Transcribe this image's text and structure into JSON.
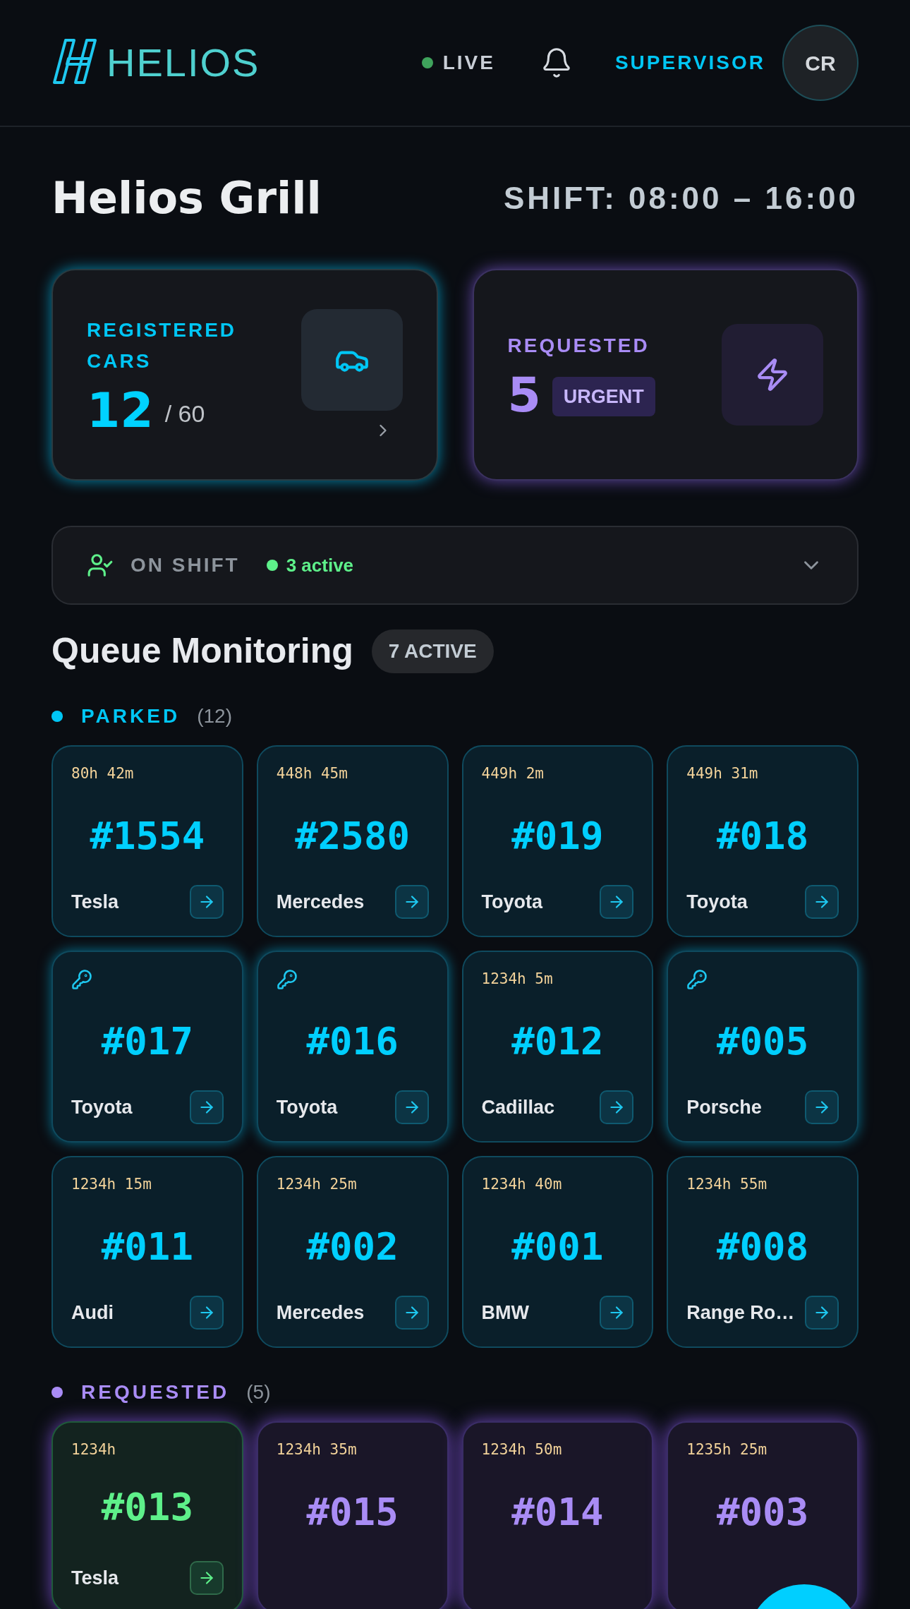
{
  "header": {
    "logo": "HELIOS",
    "live": {
      "label": "LIVE",
      "on": true
    },
    "role": "SUPERVISOR",
    "avatar": "CR"
  },
  "venue": {
    "title": "Helios Grill",
    "shift": "SHIFT: 08:00 – 16:00"
  },
  "stats": [
    {
      "kind": "registered",
      "label": "REGISTERED CARS",
      "value": "12",
      "total": "/ 60"
    },
    {
      "kind": "requested",
      "label": "REQUESTED",
      "value": "5",
      "badge": "URGENT"
    }
  ],
  "on_shift": {
    "label": "ON SHIFT",
    "status": "3 active",
    "expanded": false
  },
  "queue": {
    "title": "Queue Monitoring",
    "badge": "7 ACTIVE"
  },
  "sections": [
    {
      "kind": "parked",
      "label": "PARKED",
      "count": "(12)",
      "tiles": [
        {
          "timer": "80h 42m",
          "key": false,
          "ticket": "#1554",
          "make": "Tesla"
        },
        {
          "timer": "448h 45m",
          "key": false,
          "ticket": "#2580",
          "make": "Mercedes"
        },
        {
          "timer": "449h 2m",
          "key": false,
          "ticket": "#019",
          "make": "Toyota"
        },
        {
          "timer": "449h 31m",
          "key": false,
          "ticket": "#018",
          "make": "Toyota"
        },
        {
          "key": true,
          "ticket": "#017",
          "make": "Toyota"
        },
        {
          "key": true,
          "ticket": "#016",
          "make": "Toyota"
        },
        {
          "timer": "1234h 5m",
          "key": false,
          "ticket": "#012",
          "make": "Cadillac"
        },
        {
          "key": true,
          "ticket": "#005",
          "make": "Porsche"
        },
        {
          "timer": "1234h 15m",
          "key": false,
          "ticket": "#011",
          "make": "Audi"
        },
        {
          "timer": "1234h 25m",
          "key": false,
          "ticket": "#002",
          "make": "Mercedes"
        },
        {
          "timer": "1234h 40m",
          "key": false,
          "ticket": "#001",
          "make": "BMW"
        },
        {
          "timer": "1234h 55m",
          "key": false,
          "ticket": "#008",
          "make": "Range Ro…"
        }
      ]
    },
    {
      "kind": "requested",
      "label": "REQUESTED",
      "count": "(5)",
      "tiles": [
        {
          "timer": "1234h",
          "key": false,
          "ticket": "#013",
          "make": "Tesla",
          "ready": true
        },
        {
          "timer": "1234h 35m",
          "key": false,
          "ticket": "#015",
          "ready": false
        },
        {
          "timer": "1234h 50m",
          "key": false,
          "ticket": "#014",
          "ready": false
        },
        {
          "timer": "1235h 25m",
          "key": false,
          "ticket": "#003",
          "ready": false
        }
      ]
    }
  ]
}
